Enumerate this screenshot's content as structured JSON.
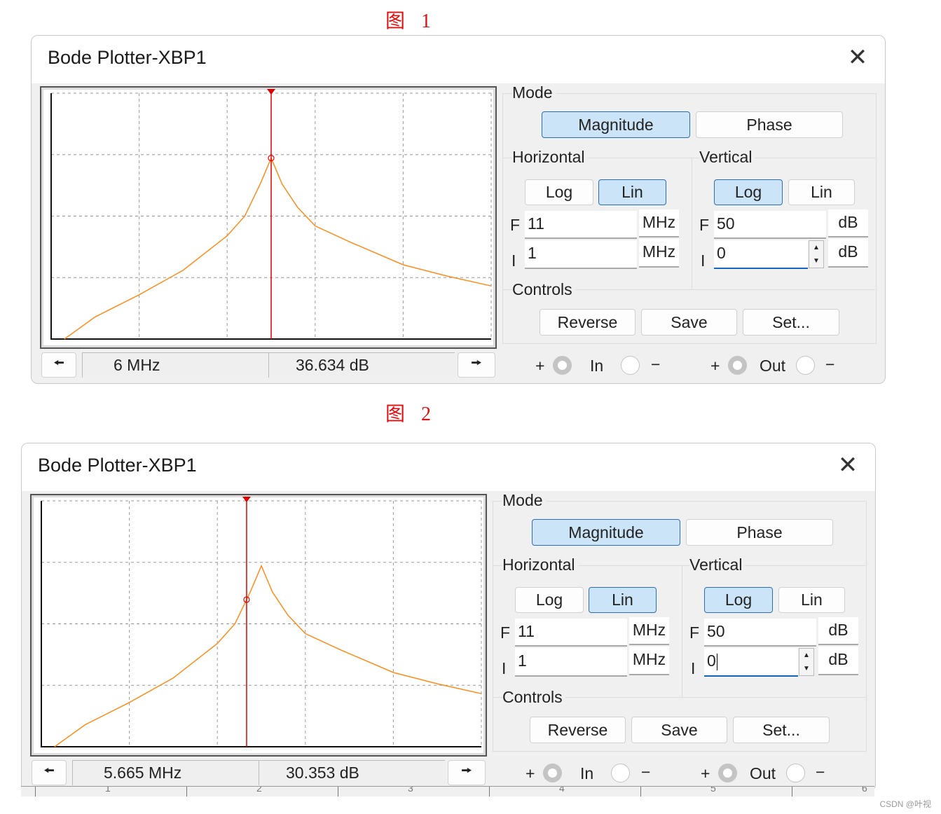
{
  "captions": [
    "图 1",
    "图 2"
  ],
  "watermark": "CSDN @叶视",
  "colors": {
    "trace": "#ff8c1a",
    "cursor": "#e00000",
    "active_button": "#cce4f7",
    "active_border": "#2a6db5",
    "focus_underline": "#1565c0"
  },
  "icons": {
    "close": "close-icon",
    "left": "arrow-left-icon",
    "right": "arrow-right-icon",
    "spin_up": "spin-up-icon",
    "spin_down": "spin-down-icon"
  },
  "windows": [
    {
      "title": "Bode Plotter-XBP1",
      "close_glyph": "✕",
      "readout_freq": "6 MHz",
      "readout_mag": "36.634 dB",
      "arrow_left": "🠘",
      "arrow_right": "🠚",
      "mode": {
        "label": "Mode",
        "magnitude": "Magnitude",
        "phase": "Phase",
        "selected": "Magnitude"
      },
      "horizontal": {
        "label": "Horizontal",
        "log": "Log",
        "lin": "Lin",
        "selected": "Lin",
        "f_label": "F",
        "f_value": "11",
        "f_unit": "MHz",
        "i_label": "I",
        "i_value": "1",
        "i_unit": "MHz"
      },
      "vertical": {
        "label": "Vertical",
        "log": "Log",
        "lin": "Lin",
        "selected": "Log",
        "f_label": "F",
        "f_value": "50",
        "f_unit": "dB",
        "i_label": "I",
        "i_value": "0",
        "i_unit": "dB"
      },
      "controls": {
        "label": "Controls",
        "reverse": "Reverse",
        "save": "Save",
        "set": "Set..."
      },
      "terminals": {
        "plus": "+",
        "minus": "−",
        "in": "In",
        "out": "Out"
      },
      "cursor_mhz": 6
    },
    {
      "title": "Bode Plotter-XBP1",
      "close_glyph": "✕",
      "readout_freq": "5.665 MHz",
      "readout_mag": "30.353 dB",
      "arrow_left": "🠘",
      "arrow_right": "🠚",
      "mode": {
        "label": "Mode",
        "magnitude": "Magnitude",
        "phase": "Phase",
        "selected": "Magnitude"
      },
      "horizontal": {
        "label": "Horizontal",
        "log": "Log",
        "lin": "Lin",
        "selected": "Lin",
        "f_label": "F",
        "f_value": "11",
        "f_unit": "MHz",
        "i_label": "I",
        "i_value": "1",
        "i_unit": "MHz"
      },
      "vertical": {
        "label": "Vertical",
        "log": "Log",
        "lin": "Lin",
        "selected": "Log",
        "f_label": "F",
        "f_value": "50",
        "f_unit": "dB",
        "i_label": "I",
        "i_value": "0",
        "i_unit": "dB"
      },
      "controls": {
        "label": "Controls",
        "reverse": "Reverse",
        "save": "Save",
        "set": "Set..."
      },
      "terminals": {
        "plus": "+",
        "minus": "−",
        "in": "In",
        "out": "Out"
      },
      "cursor_mhz": 5.665
    }
  ],
  "ruler_labels": [
    "1",
    "2",
    "3",
    "4",
    "5",
    "6"
  ],
  "chart_data": {
    "type": "line",
    "xlim": [
      1,
      11
    ],
    "ylim": [
      0,
      50
    ],
    "x_scale": "linear",
    "y_scale": "dB",
    "grid": true,
    "x_divisions": 5,
    "y_divisions": 4,
    "x_mhz": [
      1.3,
      2,
      3,
      4,
      5,
      5.4,
      5.75,
      6,
      6.25,
      6.6,
      7,
      7.8,
      9,
      10,
      11
    ],
    "y_db": [
      0,
      4.5,
      9,
      14,
      21,
      25,
      31.5,
      36.8,
      31.5,
      26.8,
      23,
      19.7,
      15.1,
      12.8,
      10.8
    ]
  }
}
